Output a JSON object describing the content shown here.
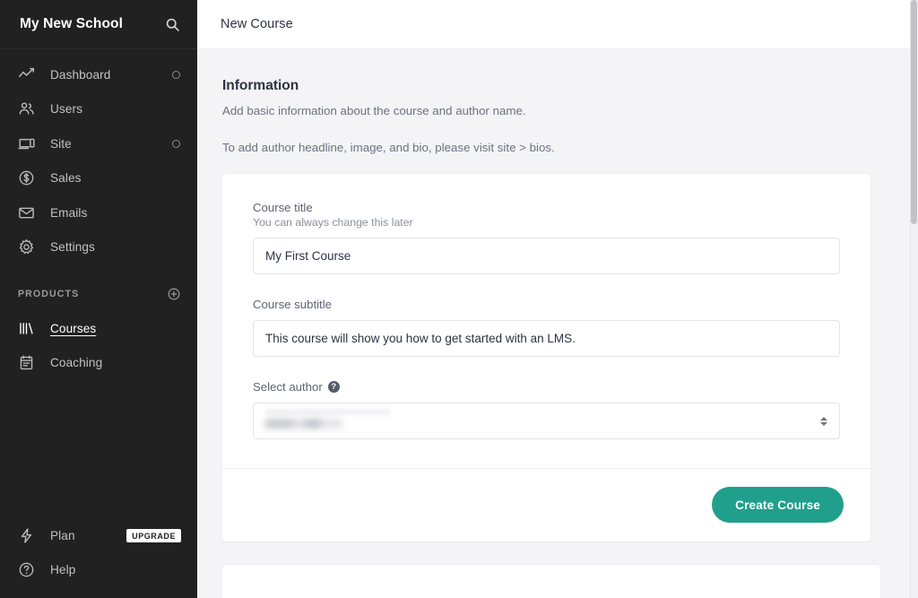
{
  "sidebar": {
    "brand": "My New School",
    "search_icon": "search-icon",
    "nav": [
      {
        "label": "Dashboard",
        "icon": "analytics-line-chart-icon",
        "external": true,
        "active": false
      },
      {
        "label": "Users",
        "icon": "users-group-icon",
        "external": false,
        "active": false
      },
      {
        "label": "Site",
        "icon": "monitor-mobile-icon",
        "external": true,
        "active": false
      },
      {
        "label": "Sales",
        "icon": "dollar-circle-icon",
        "external": false,
        "active": false
      },
      {
        "label": "Emails",
        "icon": "envelope-icon",
        "external": false,
        "active": false
      },
      {
        "label": "Settings",
        "icon": "gear-icon",
        "external": false,
        "active": false
      }
    ],
    "products_section": {
      "title": "PRODUCTS",
      "add_icon": "plus-circle-icon",
      "items": [
        {
          "label": "Courses",
          "icon": "book-spines-icon",
          "active": true
        },
        {
          "label": "Coaching",
          "icon": "clipboard-icon",
          "active": false
        }
      ]
    },
    "bottom": [
      {
        "label": "Plan",
        "icon": "lightning-bolt-icon",
        "badge": "UPGRADE"
      },
      {
        "label": "Help",
        "icon": "question-circle-icon",
        "badge": ""
      }
    ]
  },
  "topbar": {
    "title": "New Course"
  },
  "information": {
    "heading": "Information",
    "subtitle": "Add basic information about the course and author name.",
    "note": "To add author headline, image, and bio, please visit site > bios."
  },
  "form": {
    "course_title": {
      "label": "Course title",
      "hint": "You can always change this later",
      "value": "My First Course",
      "placeholder": ""
    },
    "course_subtitle": {
      "label": "Course subtitle",
      "value": "This course will show you how to get started with an LMS.",
      "placeholder": ""
    },
    "select_author": {
      "label": "Select author",
      "help_icon": "question-mark-icon",
      "help_glyph": "?",
      "value": "",
      "redacted": true
    },
    "submit_label": "Create Course"
  },
  "colors": {
    "sidebar_bg": "#212121",
    "accent": "#20a08c",
    "page_bg": "#f4f4f6",
    "card_bg": "#ffffff",
    "text_dark": "#2d3142",
    "text_muted": "#6d7180"
  }
}
